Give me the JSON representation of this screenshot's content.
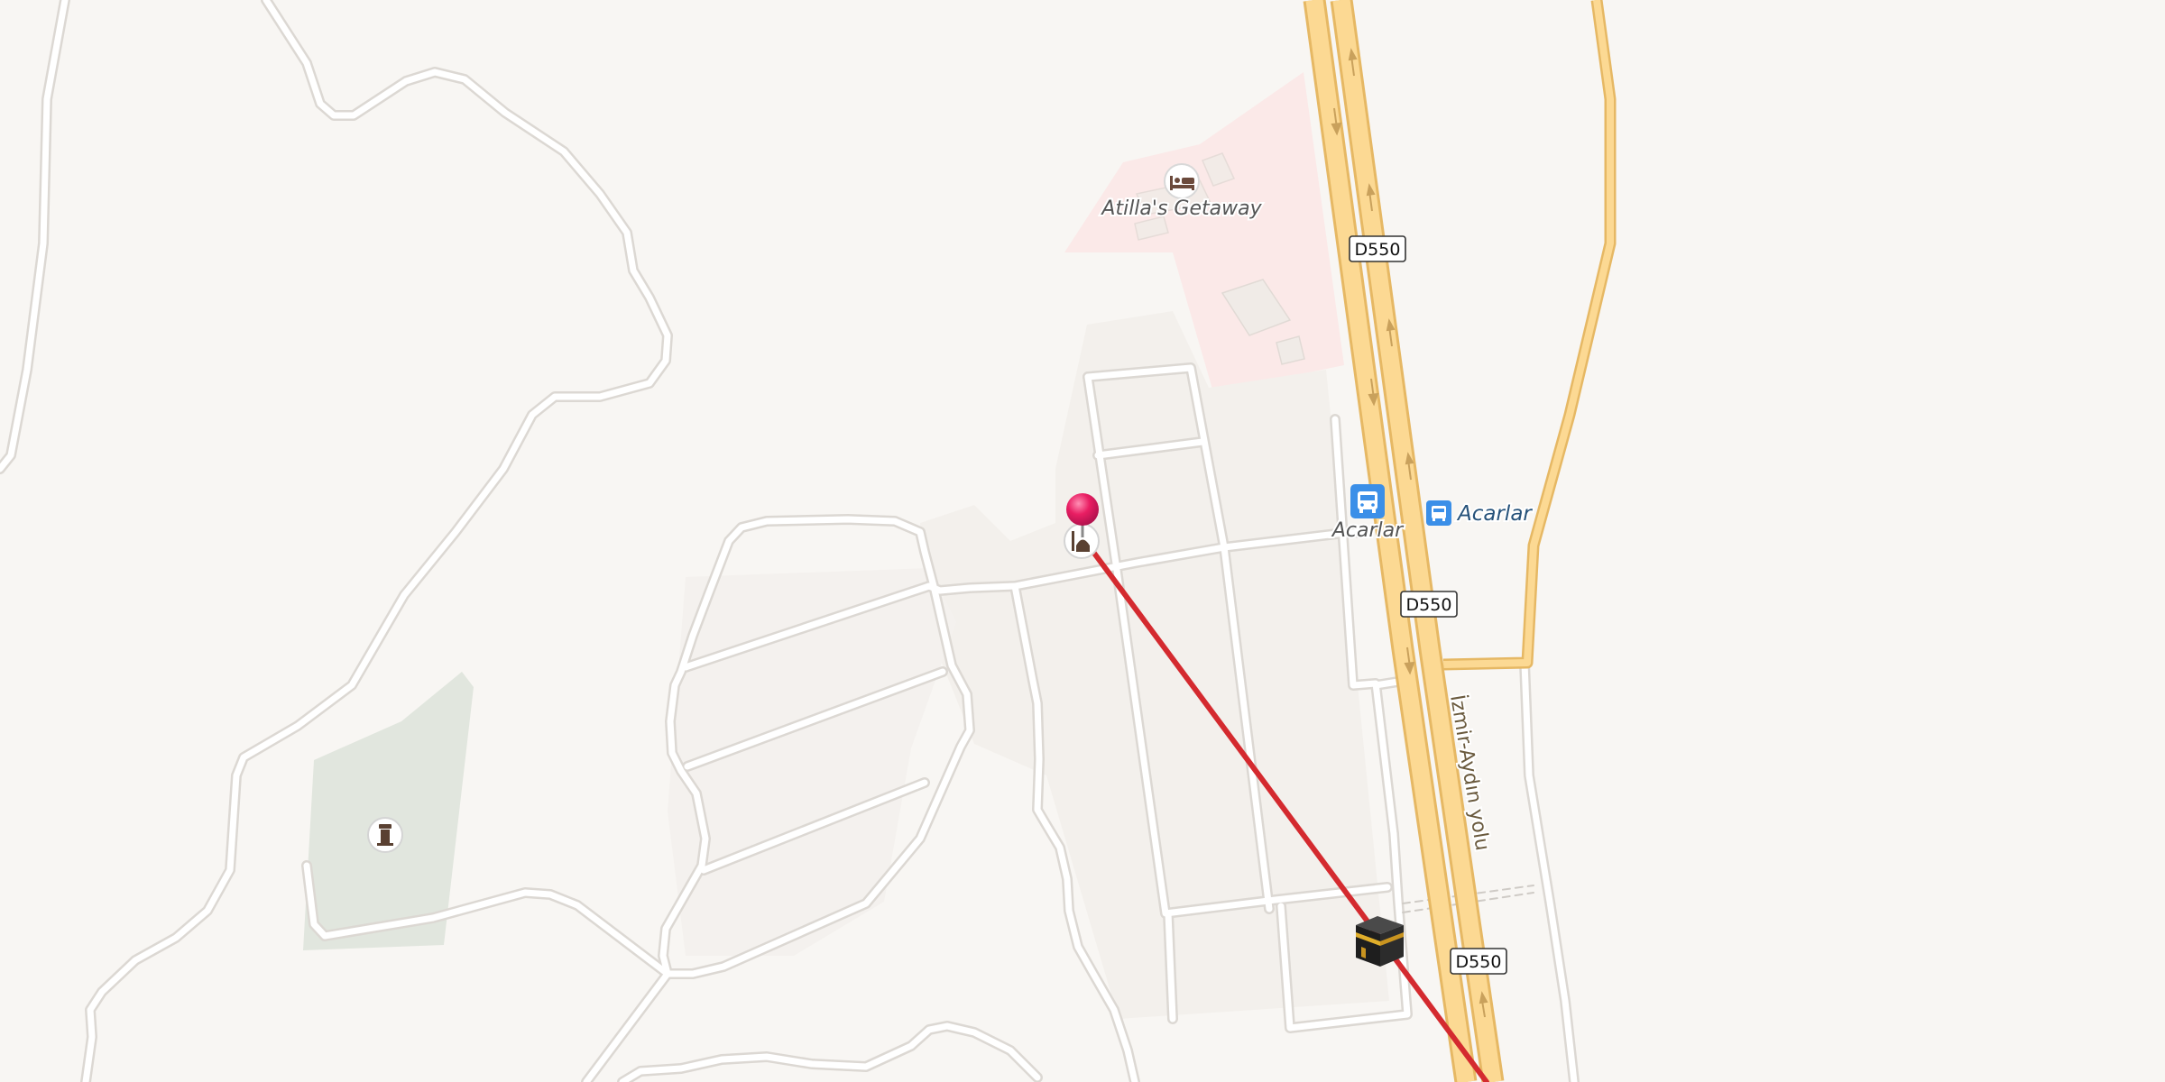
{
  "map": {
    "colors": {
      "land": "#f8f6f3",
      "minor_road": "#ffffff",
      "road_casing": "#dcd8d3",
      "highway_fill": "#fcd993",
      "highway_casing": "#e6b864",
      "hotel_area": "#fbe9e8",
      "cemetery": "#e1e6de",
      "route_line": "#d42a2f",
      "pin": "#e91e63",
      "bus_stop": "#3b8fe8",
      "italic_label": "#555555",
      "bus_label": "#26527a"
    },
    "labels": {
      "hotel_name": "Atilla's Getaway",
      "bus_stop_label_left": "Acarlar",
      "bus_stop_label_right": "Acarlar",
      "road_name": "İzmir-Aydın yolu"
    },
    "shields": [
      "D550",
      "D550",
      "D550"
    ],
    "icons": {
      "hotel": "bed-icon",
      "cemetery": "cemetery-icon",
      "mosque": "mosque-icon",
      "bus_stop_large": "bus-icon",
      "bus_stop_small": "bus-icon",
      "destination": "kaaba-icon",
      "origin_pin": "location-pin-icon"
    }
  }
}
